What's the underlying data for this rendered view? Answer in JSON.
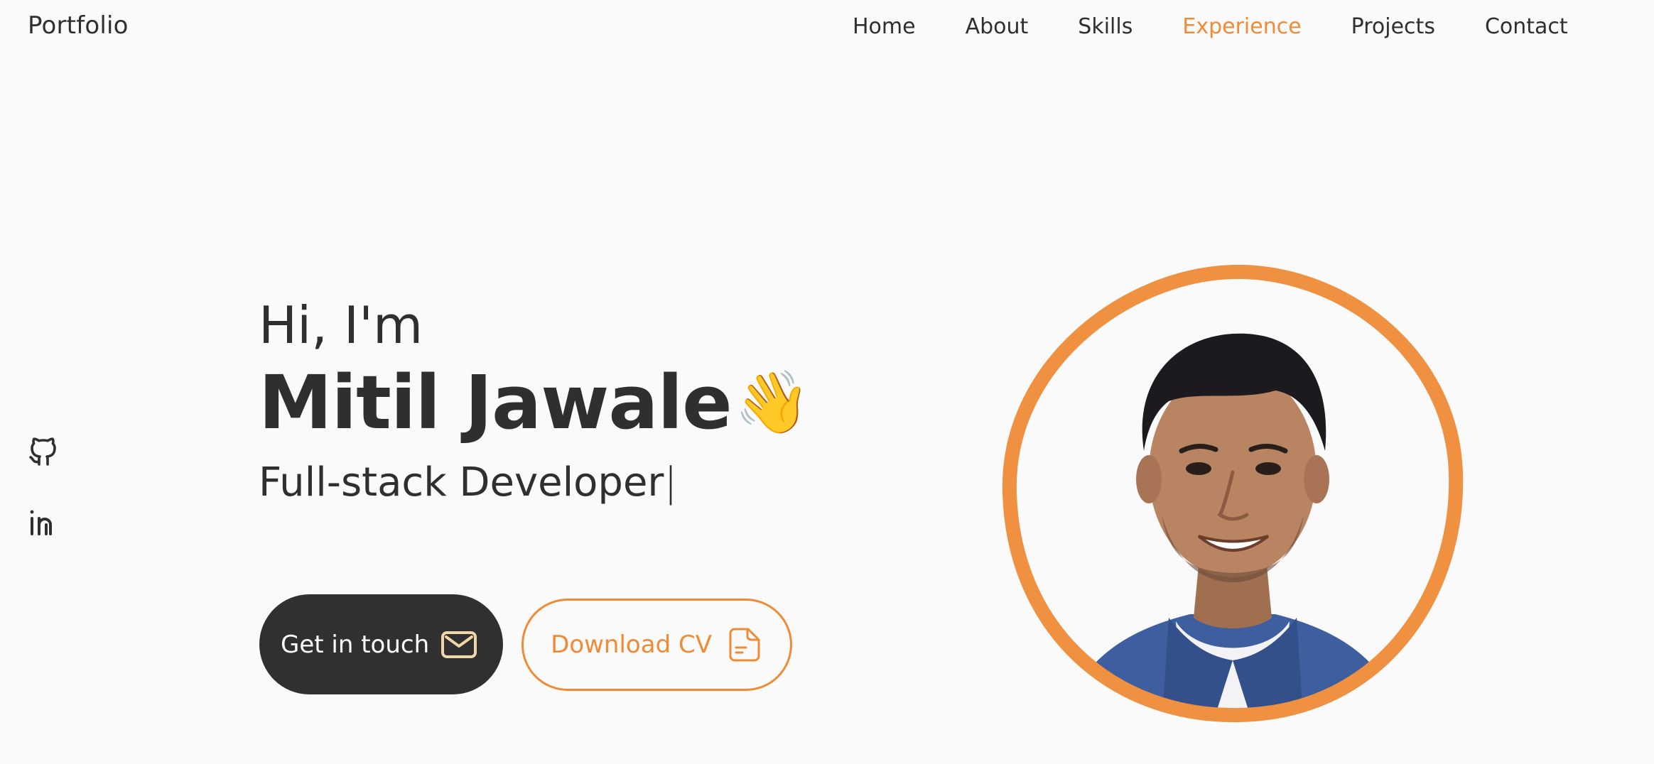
{
  "header": {
    "brand": "Portfolio",
    "nav": [
      {
        "label": "Home",
        "active": false
      },
      {
        "label": "About",
        "active": false
      },
      {
        "label": "Skills",
        "active": false
      },
      {
        "label": "Experience",
        "active": true
      },
      {
        "label": "Projects",
        "active": false
      },
      {
        "label": "Contact",
        "active": false
      }
    ]
  },
  "social": {
    "icons": [
      "github-icon",
      "linkedin-icon"
    ]
  },
  "hero": {
    "greeting": "Hi, I'm",
    "name": "Mitil Jawale",
    "wave": "👋",
    "role": "Full-stack Developer",
    "cursor": "|",
    "primary_button": {
      "label": "Get in touch",
      "icon": "envelope-icon"
    },
    "secondary_button": {
      "label": "Download CV",
      "icon": "document-icon"
    }
  },
  "colors": {
    "accent": "#ef8b36",
    "text": "#2f2f2f",
    "background": "#fafafa",
    "button_dark": "#303030"
  }
}
